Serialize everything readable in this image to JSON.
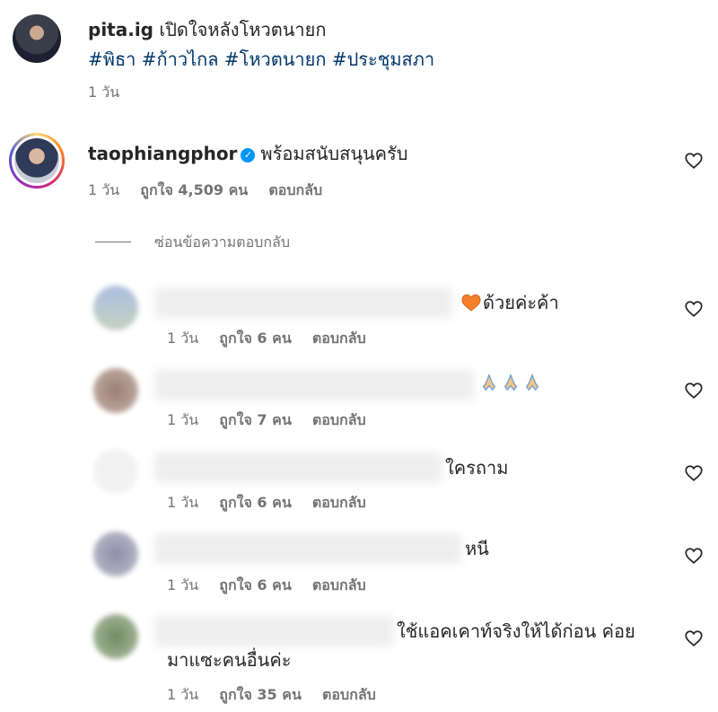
{
  "caption": {
    "username": "pita.ig",
    "text": "เปิดใจหลังโหวตนายก",
    "hashtags": "#พิธา #ก้าวไกล #โหวตนายก #ประชุมสภา",
    "time": "1 วัน"
  },
  "main_comment": {
    "username": "taophiangphor",
    "verified_icon": "verified-badge-icon",
    "text": "พร้อมสนับสนุนครับ",
    "time": "1 วัน",
    "likes": "ถูกใจ 4,509 คน",
    "reply": "ตอบกลับ"
  },
  "hide_replies_label": "ซ่อนข้อความตอบกลับ",
  "replies": [
    {
      "text": "ด้วยค่ะค้า",
      "emoji": "orange-heart-icon",
      "time": "1 วัน",
      "likes": "ถูกใจ 6 คน",
      "reply": "ตอบกลับ"
    },
    {
      "text": "",
      "emoji": "folded-hands-icon",
      "time": "1 วัน",
      "likes": "ถูกใจ 7 คน",
      "reply": "ตอบกลับ"
    },
    {
      "text": "ใครถาม",
      "time": "1 วัน",
      "likes": "ถูกใจ 6 คน",
      "reply": "ตอบกลับ"
    },
    {
      "text": "หนี",
      "time": "1 วัน",
      "likes": "ถูกใจ 6 คน",
      "reply": "ตอบกลับ"
    },
    {
      "text_line1": "ใช้แอคเคาท์จริงให้ได้ก่อน ค่อย",
      "text_line2": "มาแซะคนอื่นค่ะ",
      "time": "1 วัน",
      "likes": "ถูกใจ 35 คน",
      "reply": "ตอบกลับ"
    }
  ],
  "colors": {
    "link": "#00376b",
    "secondary": "#737373",
    "verified": "#0095f6",
    "heart_emoji": "#f4802b"
  }
}
